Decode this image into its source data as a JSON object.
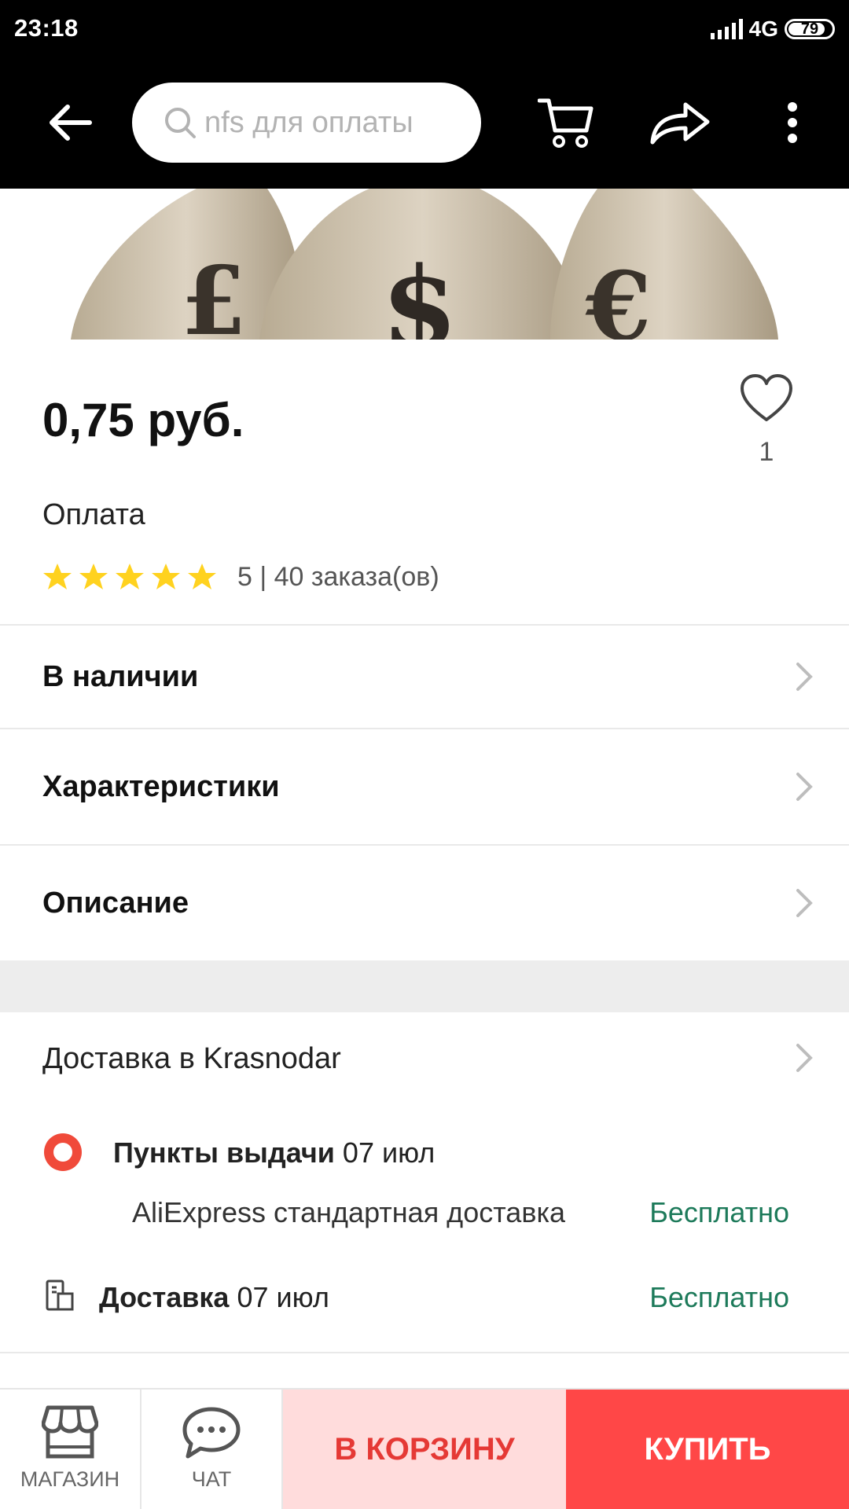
{
  "status_bar": {
    "time": "23:18",
    "network": "4G",
    "battery": "79"
  },
  "app_bar": {
    "search_query": "nfs  для оплаты"
  },
  "product": {
    "price": "0,75 руб.",
    "wishlist_count": "1",
    "title": "Оплата",
    "rating_value": "5",
    "orders": "5 | 40 заказа(ов)"
  },
  "rows": {
    "availability": "В наличии",
    "specs": "Характеристики",
    "description": "Описание"
  },
  "delivery": {
    "title": "Доставка в Krasnodar",
    "pickup_label": "Пункты выдачи",
    "pickup_date": " 07 июл",
    "standard_method": "AliExpress стандартная доставка",
    "standard_price": "Бесплатно",
    "courier_label": "Доставка",
    "courier_date": " 07 июл",
    "courier_price": "Бесплатно"
  },
  "bottom_bar": {
    "store_label": "МАГАЗИН",
    "chat_label": "ЧАТ",
    "add_to_cart": "В КОРЗИНУ",
    "buy_now": "КУПИТЬ"
  },
  "colors": {
    "accent": "#ff4747",
    "star": "#ffd21f",
    "free": "#1d7a5a",
    "pickup": "#f04a3a"
  }
}
